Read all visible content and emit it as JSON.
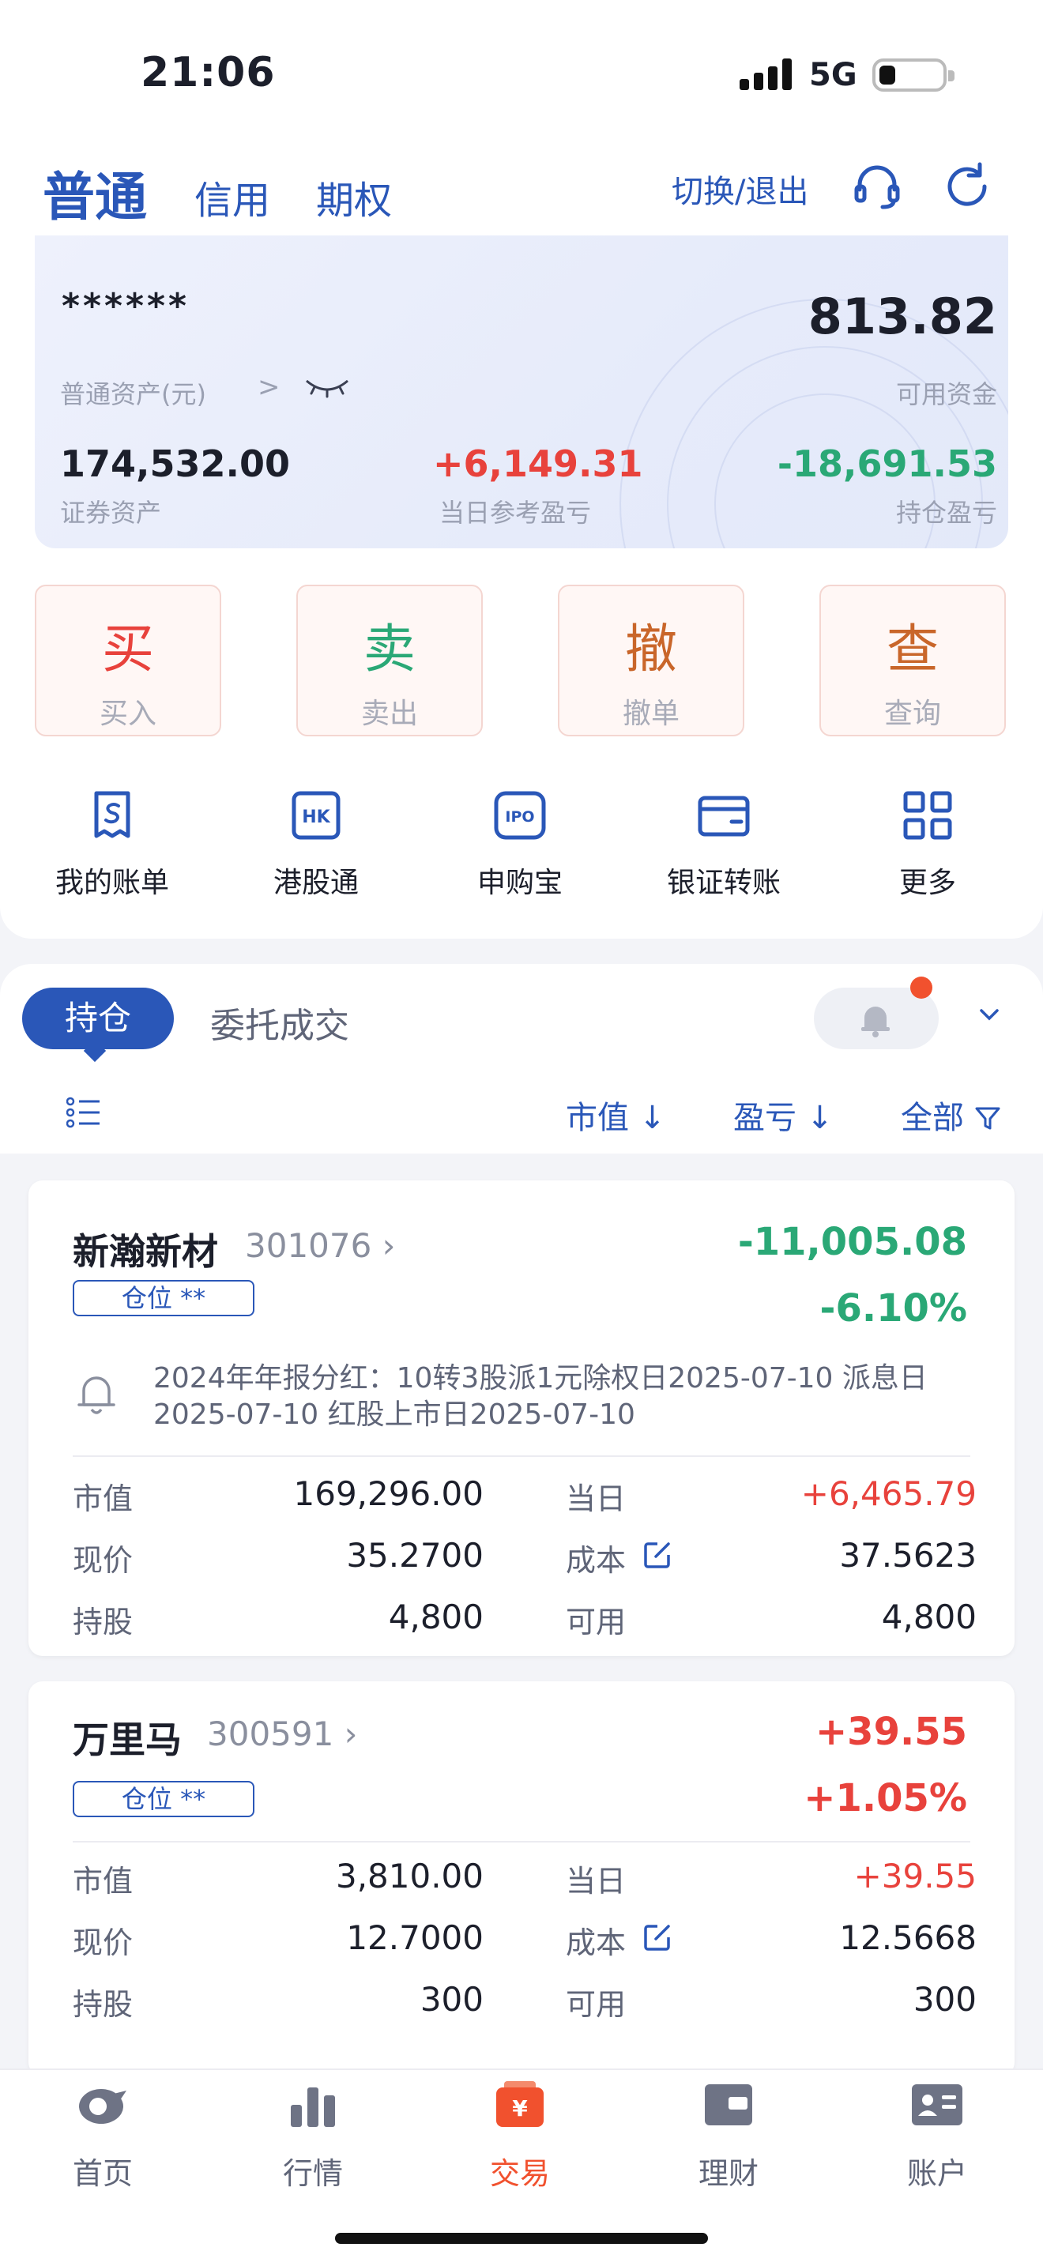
{
  "status_bar": {
    "time": "21:06",
    "network": "5G"
  },
  "header": {
    "tabs": [
      "普通",
      "信用",
      "期权"
    ],
    "switch_exit": "切换/退出"
  },
  "asset": {
    "masked_total": "******",
    "asset_label": "普通资产(元)",
    "available_value": "813.82",
    "available_label": "可用资金",
    "securities_value": "174,532.00",
    "securities_label": "证券资产",
    "daily_pnl_value": "+6,149.31",
    "daily_pnl_label": "当日参考盈亏",
    "position_pnl_value": "-18,691.53",
    "position_pnl_label": "持仓盈亏"
  },
  "quick_actions": [
    {
      "big": "买",
      "small": "买入",
      "color": "#e8423c"
    },
    {
      "big": "卖",
      "small": "卖出",
      "color": "#2aa876"
    },
    {
      "big": "撤",
      "small": "撤单",
      "color": "#c9662a"
    },
    {
      "big": "查",
      "small": "查询",
      "color": "#c9662a"
    }
  ],
  "functions": [
    {
      "label": "我的账单",
      "icon": "bill-icon"
    },
    {
      "label": "港股通",
      "icon": "hk-icon"
    },
    {
      "label": "申购宝",
      "icon": "ipo-icon"
    },
    {
      "label": "银证转账",
      "icon": "transfer-icon"
    },
    {
      "label": "更多",
      "icon": "grid-more-icon"
    }
  ],
  "holdings_tabs": {
    "active": "持仓",
    "other": "委托成交"
  },
  "sort": {
    "market_value": "市值 ↓",
    "pnl": "盈亏 ↓",
    "all": "全部"
  },
  "holdings": [
    {
      "name": "新瀚新材",
      "code": "301076 ›",
      "pnl": "-11,005.08",
      "pct": "-6.10%",
      "tag": "仓位 **",
      "notice": "2024年年报分红：10转3股派1元除权日2025-07-10 派息日2025-07-10 红股上市日2025-07-10",
      "labels": {
        "mv": "市值",
        "price": "现价",
        "shares": "持股",
        "day": "当日",
        "cost": "成本",
        "avail": "可用"
      },
      "market_value": "169,296.00",
      "price": "35.2700",
      "shares": "4,800",
      "day_pnl": "+6,465.79",
      "cost": "37.5623",
      "available": "4,800"
    },
    {
      "name": "万里马",
      "code": "300591 ›",
      "pnl": "+39.55",
      "pct": "+1.05%",
      "tag": "仓位 **",
      "labels": {
        "mv": "市值",
        "price": "现价",
        "shares": "持股",
        "day": "当日",
        "cost": "成本",
        "avail": "可用"
      },
      "market_value": "3,810.00",
      "price": "12.7000",
      "shares": "300",
      "day_pnl": "+39.55",
      "cost": "12.5668",
      "available": "300"
    }
  ],
  "bottom_nav": [
    {
      "label": "首页",
      "icon": "home-icon"
    },
    {
      "label": "行情",
      "icon": "market-icon"
    },
    {
      "label": "交易",
      "icon": "trade-icon",
      "active": true
    },
    {
      "label": "理财",
      "icon": "wealth-icon"
    },
    {
      "label": "账户",
      "icon": "account-icon"
    }
  ],
  "colors": {
    "brand": "#2a57b8",
    "up": "#e8423c",
    "down": "#2aa876",
    "active_nav": "#f1512e"
  }
}
